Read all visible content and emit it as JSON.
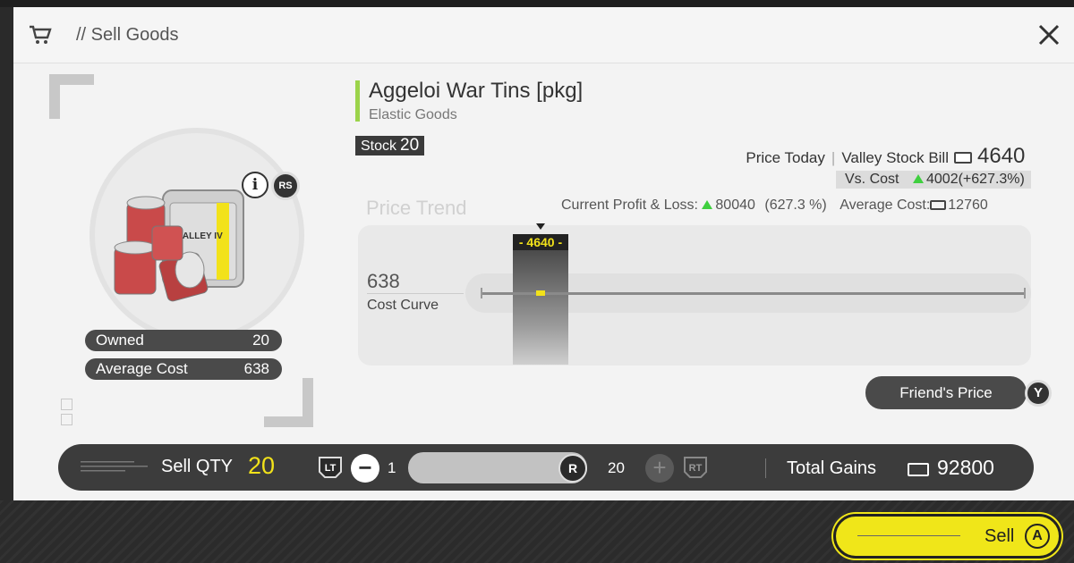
{
  "header": {
    "title": "// Sell Goods"
  },
  "item": {
    "name": "Aggeloi War Tins [pkg]",
    "category": "Elastic Goods",
    "stock_label": "Stock",
    "stock_value": "20",
    "info_button": "i",
    "rs_button": "RS",
    "image_label": "VALLEY IV",
    "owned_label": "Owned",
    "owned_value": "20",
    "avg_cost_label": "Average Cost",
    "avg_cost_value": "638"
  },
  "pricing": {
    "price_today_label": "Price Today",
    "bill_label": "Valley Stock Bill",
    "price_today_value": "4640",
    "vs_cost_label": "Vs. Cost",
    "vs_cost_value": "4002(+627.3%)",
    "trend_title": "Price Trend",
    "profit_loss_label": "Current Profit & Loss:",
    "profit_loss_value": "80040",
    "profit_loss_pct": "(627.3 %)",
    "average_cost_label": "Average Cost:",
    "average_cost_value": "12760"
  },
  "chart": {
    "cost_curve_value": "638",
    "cost_curve_label": "Cost Curve",
    "today_marker": "- 4640 -"
  },
  "friend_price": {
    "label": "Friend's Price",
    "key": "Y"
  },
  "quantity": {
    "label": "Sell QTY",
    "value": "20",
    "lt_key": "LT",
    "rt_key": "RT",
    "minus": "−",
    "plus": "+",
    "min": "1",
    "max": "20",
    "knob_key": "R",
    "slider_fraction": 1.0
  },
  "totals": {
    "label": "Total Gains",
    "value": "92800"
  },
  "sell": {
    "label": "Sell",
    "key": "A"
  },
  "colors": {
    "accent_yellow": "#f2e21a",
    "green_up": "#3fcf3f",
    "name_bar": "#9bd34a"
  }
}
